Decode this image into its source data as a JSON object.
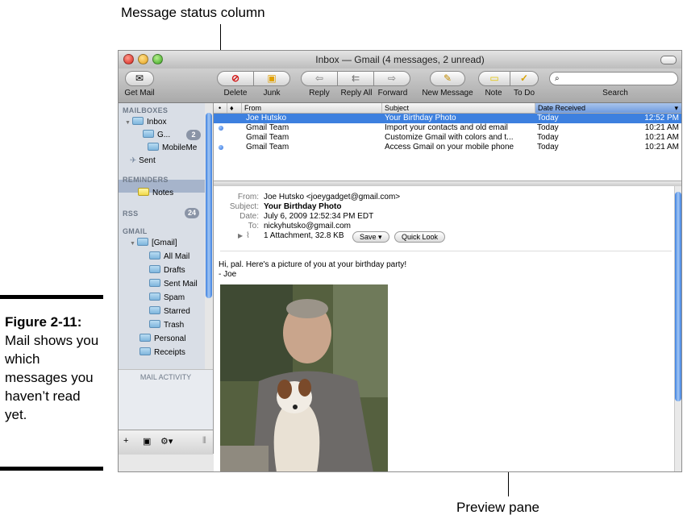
{
  "callouts": {
    "status": "Message status column",
    "preview": "Preview pane"
  },
  "figure": {
    "label": "Figure 2-11:",
    "text": "Mail shows you which messages you haven’t read yet."
  },
  "window": {
    "title": "Inbox — Gmail (4 messages, 2 unread)"
  },
  "toolbar": {
    "get_mail": "Get Mail",
    "delete": "Delete",
    "junk": "Junk",
    "reply": "Reply",
    "reply_all": "Reply All",
    "forward": "Forward",
    "new_message": "New Message",
    "note": "Note",
    "todo": "To Do",
    "search_label": "Search",
    "search_value": ""
  },
  "sidebar": {
    "mailboxes": "MAILBOXES",
    "inbox": "Inbox",
    "gmail_account": "G...",
    "gmail_badge": "2",
    "mobileme": "MobileMe",
    "sent": "Sent",
    "reminders": "REMINDERS",
    "notes": "Notes",
    "rss": "RSS",
    "rss_badge": "24",
    "gmail": "GMAIL",
    "gmail_folder": "[Gmail]",
    "all_mail": "All Mail",
    "drafts": "Drafts",
    "sent_mail": "Sent Mail",
    "spam": "Spam",
    "starred": "Starred",
    "trash": "Trash",
    "personal": "Personal",
    "receipts": "Receipts",
    "mail_activity": "MAIL ACTIVITY"
  },
  "list": {
    "headers": {
      "status": "•",
      "flag": "♦",
      "from": "From",
      "subject": "Subject",
      "date": "Date Received"
    },
    "rows": [
      {
        "from": "Joe Hutsko",
        "subject": "Your Birthday Photo",
        "day": "Today",
        "time": "12:52 PM"
      },
      {
        "from": "Gmail Team",
        "subject": "Import your contacts and old email",
        "day": "Today",
        "time": "10:21 AM"
      },
      {
        "from": "Gmail Team",
        "subject": "Customize Gmail with colors and t...",
        "day": "Today",
        "time": "10:21 AM"
      },
      {
        "from": "Gmail Team",
        "subject": "Access Gmail on your mobile phone",
        "day": "Today",
        "time": "10:21 AM"
      }
    ]
  },
  "preview": {
    "from_label": "From:",
    "from": "Joe Hutsko <joeygadget@gmail.com>",
    "subject_label": "Subject:",
    "subject": "Your Birthday Photo",
    "date_label": "Date:",
    "date": "July 6, 2009 12:52:34 PM EDT",
    "to_label": "To:",
    "to": "nickyhutsko@gmail.com",
    "attachment": "1 Attachment, 32.8 KB",
    "save": "Save",
    "quick_look": "Quick Look",
    "body_line1": "Hi, pal. Here's a picture of you at your birthday party!",
    "body_line2": "- Joe"
  }
}
